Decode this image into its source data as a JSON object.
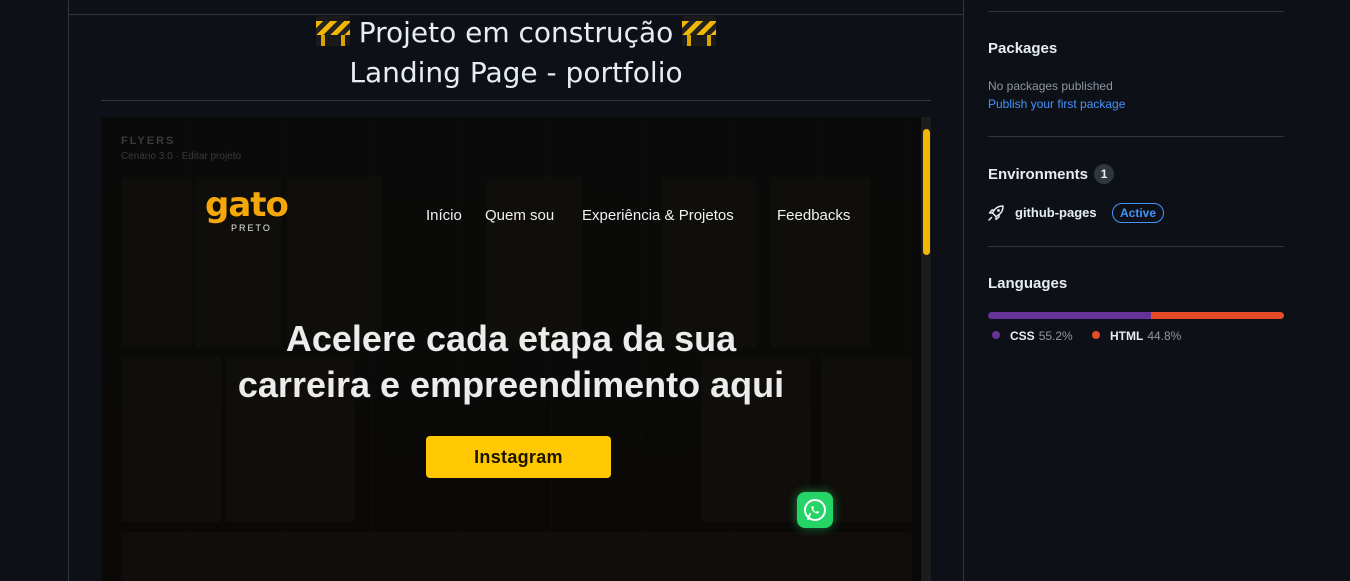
{
  "readme": {
    "title_line1": "Projeto em construção",
    "title_line2": "Landing Page - portfolio",
    "title_icon": "construction-barrier-icon"
  },
  "preview": {
    "flyers_heading": "FLYERS",
    "flyers_sub": "Cenário 3.0  ·  Editar projeto",
    "logo_main": "gato",
    "logo_sub": "PRETO",
    "nav": [
      "Início",
      "Quem sou",
      "Experiência & Projetos",
      "Feedbacks"
    ],
    "hero_line1": "Acelere cada etapa da sua",
    "hero_line2": "carreira e empreendimento aqui",
    "cta_label": "Instagram",
    "whatsapp_icon": "whatsapp-icon",
    "accent_color": "#ffc800"
  },
  "sidebar": {
    "packages": {
      "heading": "Packages",
      "empty_text": "No packages published",
      "link": "Publish your first package"
    },
    "environments": {
      "heading": "Environments",
      "count": "1",
      "items": [
        {
          "name": "github-pages",
          "status": "Active",
          "icon": "rocket-icon"
        }
      ]
    },
    "languages": {
      "heading": "Languages",
      "items": [
        {
          "name": "CSS",
          "percent_label": "55.2%",
          "percent": 55.2,
          "color": "#663399"
        },
        {
          "name": "HTML",
          "percent_label": "44.8%",
          "percent": 44.8,
          "color": "#e34c26"
        }
      ]
    }
  }
}
